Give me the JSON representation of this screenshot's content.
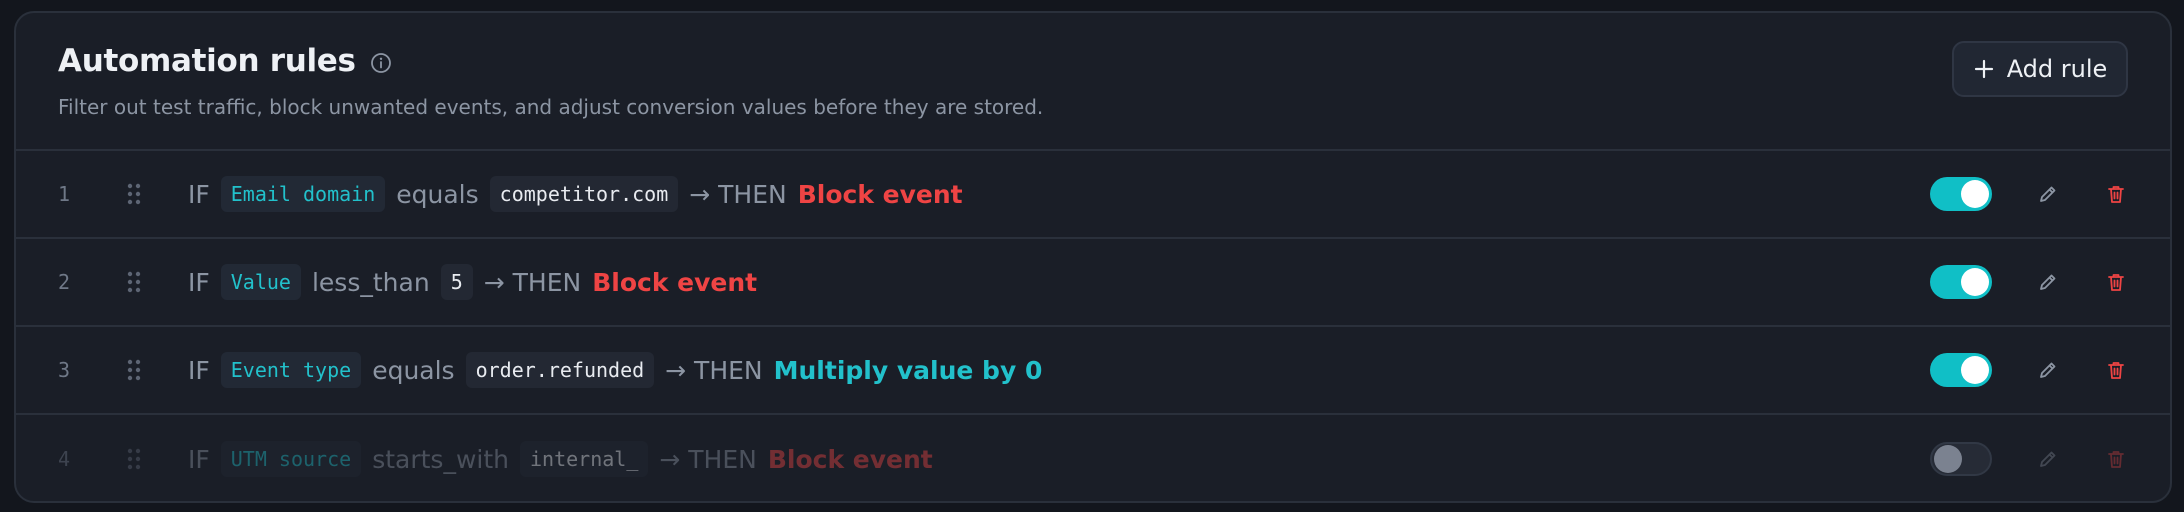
{
  "header": {
    "title": "Automation rules",
    "subtitle": "Filter out test traffic, block unwanted events, and adjust conversion values before they are stored.",
    "add_rule_label": "Add rule"
  },
  "rules": [
    {
      "index": "1",
      "if_label": "IF",
      "field": "Email domain",
      "operator": "equals",
      "value": "competitor.com",
      "then_label": "→ THEN",
      "action": "Block event",
      "action_kind": "block",
      "enabled": true
    },
    {
      "index": "2",
      "if_label": "IF",
      "field": "Value",
      "operator": "less_than",
      "value": "5",
      "then_label": "→ THEN",
      "action": "Block event",
      "action_kind": "block",
      "enabled": true
    },
    {
      "index": "3",
      "if_label": "IF",
      "field": "Event type",
      "operator": "equals",
      "value": "order.refunded",
      "then_label": "→ THEN",
      "action": "Multiply value by 0",
      "action_kind": "multiply",
      "enabled": true
    },
    {
      "index": "4",
      "if_label": "IF",
      "field": "UTM source",
      "operator": "starts_with",
      "value": "internal_",
      "then_label": "→ THEN",
      "action": "Block event",
      "action_kind": "block",
      "enabled": false
    }
  ],
  "icons": {
    "info": "info-icon",
    "add": "plus-icon",
    "drag": "drag-handle-icon",
    "edit": "pencil-icon",
    "delete": "trash-icon"
  },
  "colors": {
    "accent": "#10bfc6",
    "field": "#22c1cb",
    "danger": "#ef4444",
    "background": "#1a1e27"
  }
}
